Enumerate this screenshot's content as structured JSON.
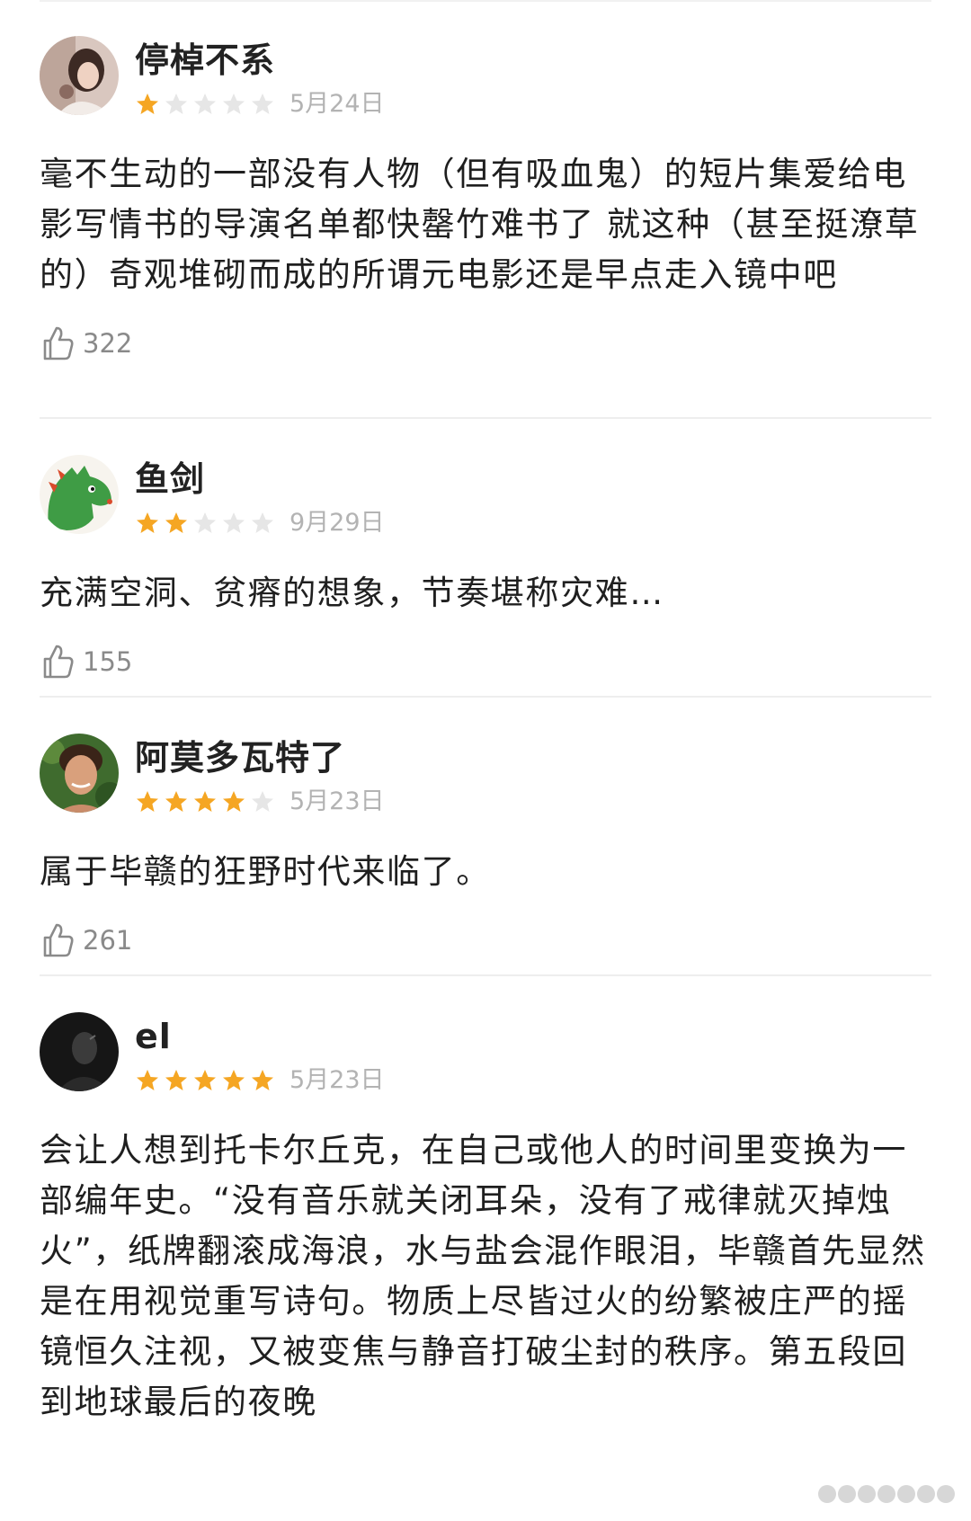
{
  "reviews": [
    {
      "username": "停棹不系",
      "rating": 1,
      "date": "5月24日",
      "content": "毫不生动的一部没有人物（但有吸血鬼）的短片集爱给电影写情书的导演名单都快罄竹难书了 就这种（甚至挺潦草的）奇观堆砌而成的所谓元电影还是早点走入镜中吧",
      "likes": "322",
      "avatar": "avatar-photo-woman"
    },
    {
      "username": "鱼剑",
      "rating": 2,
      "date": "9月29日",
      "content": "充满空洞、贫瘠的想象，节奏堪称灾难…",
      "likes": "155",
      "avatar": "avatar-green-dinosaur"
    },
    {
      "username": "阿莫多瓦特了",
      "rating": 4,
      "date": "5月23日",
      "content": "属于毕赣的狂野时代来临了。",
      "likes": "261",
      "avatar": "avatar-photo-man"
    },
    {
      "username": "el",
      "rating": 5,
      "date": "5月23日",
      "content": "会让人想到托卡尔丘克，在自己或他人的时间里变换为一部编年史。“没有音乐就关闭耳朵，没有了戒律就灭掉烛火”，纸牌翻滚成海浪，水与盐会混作眼泪，毕赣首先显然是在用视觉重写诗句。物质上尽皆过火的纷繁被庄严的摇镜恒久注视，又被变焦与静音打破尘封的秩序。第五段回到地球最后的夜晚",
      "likes": "",
      "avatar": "avatar-dark-photo"
    }
  ],
  "colors": {
    "star_filled": "#f5a623",
    "star_empty": "#e6e6e6",
    "date": "#b3b3b3",
    "like_count": "#8a8a8a"
  },
  "icons": {
    "like": "thumbs-up-icon",
    "star": "star-icon"
  }
}
